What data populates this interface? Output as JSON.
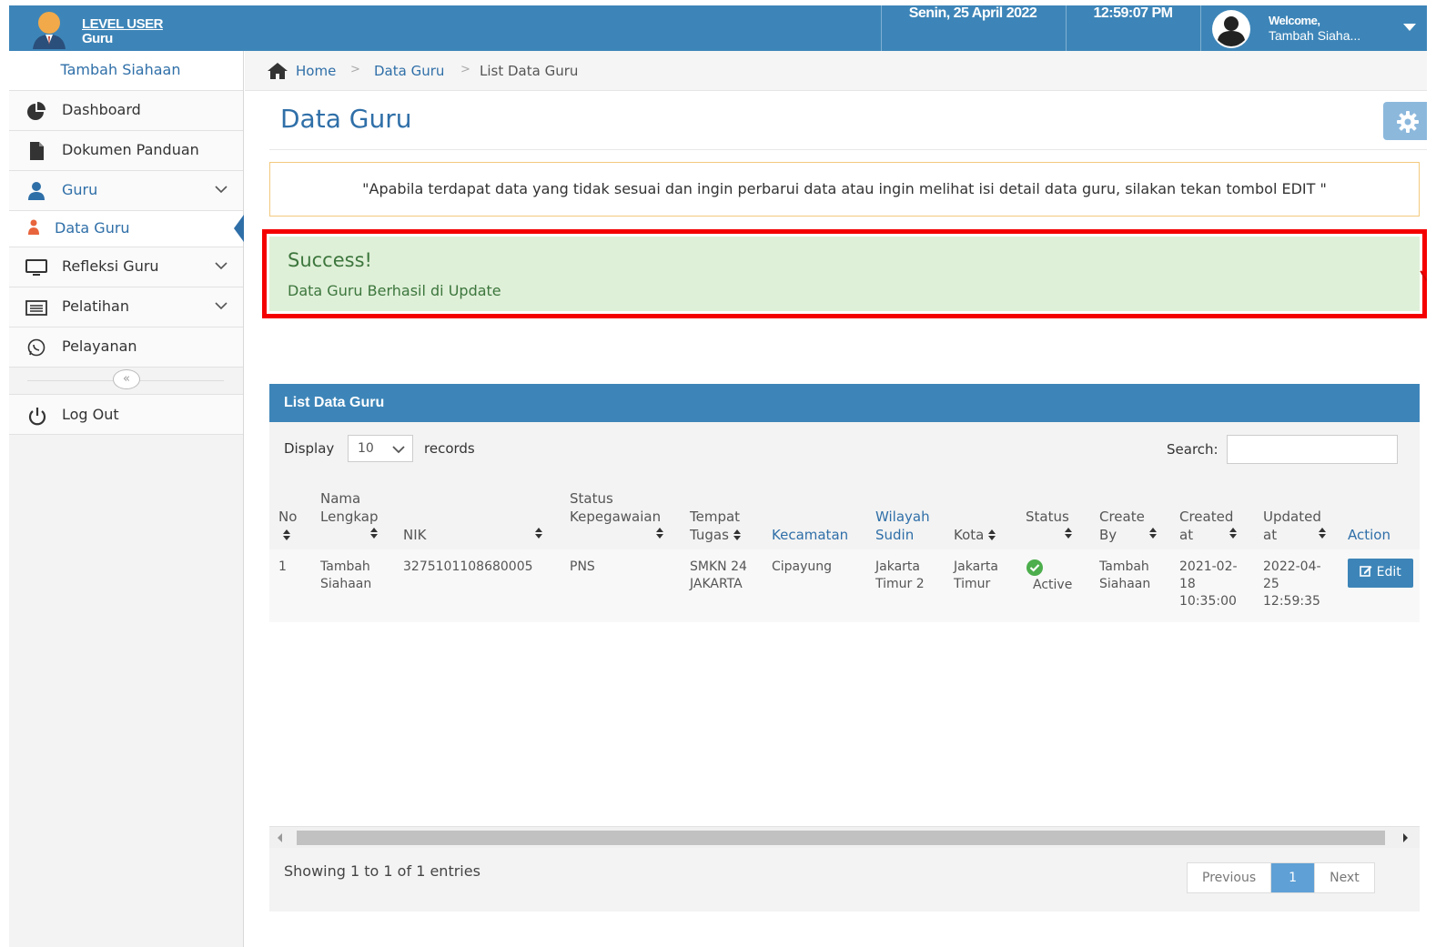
{
  "header": {
    "brand_line1": "LEVEL USER",
    "brand_line2": "Guru",
    "date": "Senin, 25 April 2022",
    "time": "12:59:07 PM",
    "welcome": "Welcome,",
    "user_name": "Tambah Siaha..."
  },
  "sidebar": {
    "user": "Tambah Siahaan",
    "items": [
      {
        "label": "Dashboard",
        "icon": "pie-chart-icon"
      },
      {
        "label": "Dokumen Panduan",
        "icon": "document-icon"
      },
      {
        "label": "Guru",
        "icon": "user-icon"
      },
      {
        "label": "Data Guru",
        "icon": "teacher-icon"
      },
      {
        "label": "Refleksi Guru",
        "icon": "monitor-icon"
      },
      {
        "label": "Pelatihan",
        "icon": "list-icon"
      },
      {
        "label": "Pelayanan",
        "icon": "whatsapp-icon"
      }
    ],
    "collapse": "«",
    "logout": "Log Out"
  },
  "breadcrumb": {
    "home": "Home",
    "level2": "Data Guru",
    "current": "List Data Guru"
  },
  "page": {
    "title": "Data Guru",
    "notice": "\"Apabila terdapat data yang tidak sesuai dan ingin perbarui data atau ingin melihat isi detail data guru, silakan tekan tombol EDIT \"",
    "alert_title": "Success!",
    "alert_message": "Data Guru Berhasil di Update"
  },
  "panel": {
    "title": "List Data Guru",
    "display_label": "Display",
    "display_value": "10",
    "records_label": "records",
    "search_label": "Search:",
    "columns": [
      "No",
      "Nama Lengkap",
      "NIK",
      "Status Kepegawaian",
      "Tempat Tugas",
      "Kecamatan",
      "Wilayah Sudin",
      "Kota",
      "Status",
      "Create By",
      "Created at",
      "Updated at",
      "Action"
    ],
    "rows": [
      {
        "no": "1",
        "nama": "Tambah Siahaan",
        "nik": "3275101108680005",
        "status_kepegawaian": "PNS",
        "tempat_tugas": "SMKN 24 JAKARTA",
        "kecamatan": "Cipayung",
        "wilayah": "Jakarta Timur 2",
        "kota": "Jakarta Timur",
        "status": "Active",
        "create_by": "Tambah Siahaan",
        "created_at": "2021-02-18 10:35:00",
        "updated_at": "2022-04-25 12:59:35",
        "action": "Edit"
      }
    ],
    "info": "Showing 1 to 1 of 1 entries",
    "pager": {
      "previous": "Previous",
      "current": "1",
      "next": "Next"
    }
  },
  "colors": {
    "primary": "#3d85b8",
    "link": "#2f6fa8",
    "success_bg": "#dff0d8",
    "success_text": "#3c763d",
    "highlight_border": "#f40000",
    "notice_border": "#f3c97e"
  }
}
